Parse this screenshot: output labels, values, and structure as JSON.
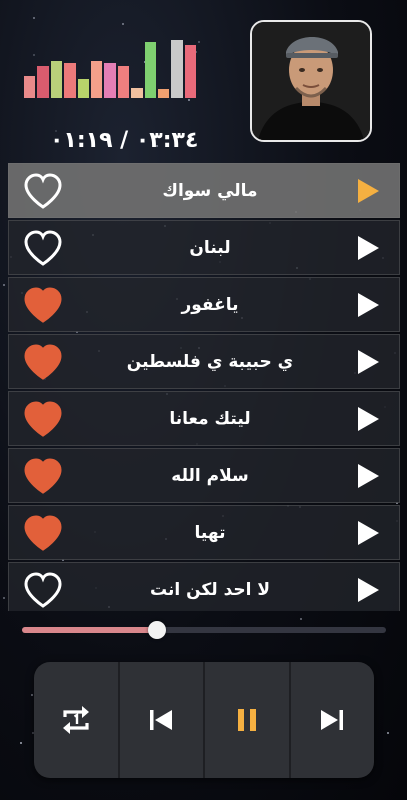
{
  "player": {
    "time_display": "٠٣:٣٤ / ٠١:١٩",
    "progress": 0.37,
    "equalizer": {
      "levels": [
        0.38,
        0.55,
        0.63,
        0.6,
        0.32,
        0.63,
        0.6,
        0.55,
        0.17,
        0.97,
        0.15,
        1.0,
        0.92
      ],
      "colors": [
        "#e98a8a",
        "#d95c6e",
        "#b9cf7a",
        "#ec7a7a",
        "#b8d46a",
        "#f4a08a",
        "#e47fb5",
        "#ef7f7f",
        "#f0c0a0",
        "#7fd070",
        "#f0a070",
        "#c9c9c9",
        "#e96a7a"
      ]
    }
  },
  "playlist": [
    {
      "title": "مالي سواك",
      "favorite": false,
      "active": true
    },
    {
      "title": "لبنان",
      "favorite": false,
      "active": false
    },
    {
      "title": "ياغفور",
      "favorite": true,
      "active": false
    },
    {
      "title": "ي حبيبة ي فلسطين",
      "favorite": true,
      "active": false
    },
    {
      "title": "ليتك معانا",
      "favorite": true,
      "active": false
    },
    {
      "title": "سلام الله",
      "favorite": true,
      "active": false
    },
    {
      "title": "تهيا",
      "favorite": true,
      "active": false
    },
    {
      "title": "لا احد لكن انت",
      "favorite": false,
      "active": false
    }
  ],
  "controls": [
    {
      "name": "repeat-one-button",
      "icon": "repeat-one-icon"
    },
    {
      "name": "previous-button",
      "icon": "skip-previous-icon"
    },
    {
      "name": "pause-button",
      "icon": "pause-icon"
    },
    {
      "name": "next-button",
      "icon": "skip-next-icon"
    }
  ],
  "colors": {
    "accent": "#f5b041",
    "heart_filled": "#e2603a",
    "seek_fill": "#d9878c"
  }
}
